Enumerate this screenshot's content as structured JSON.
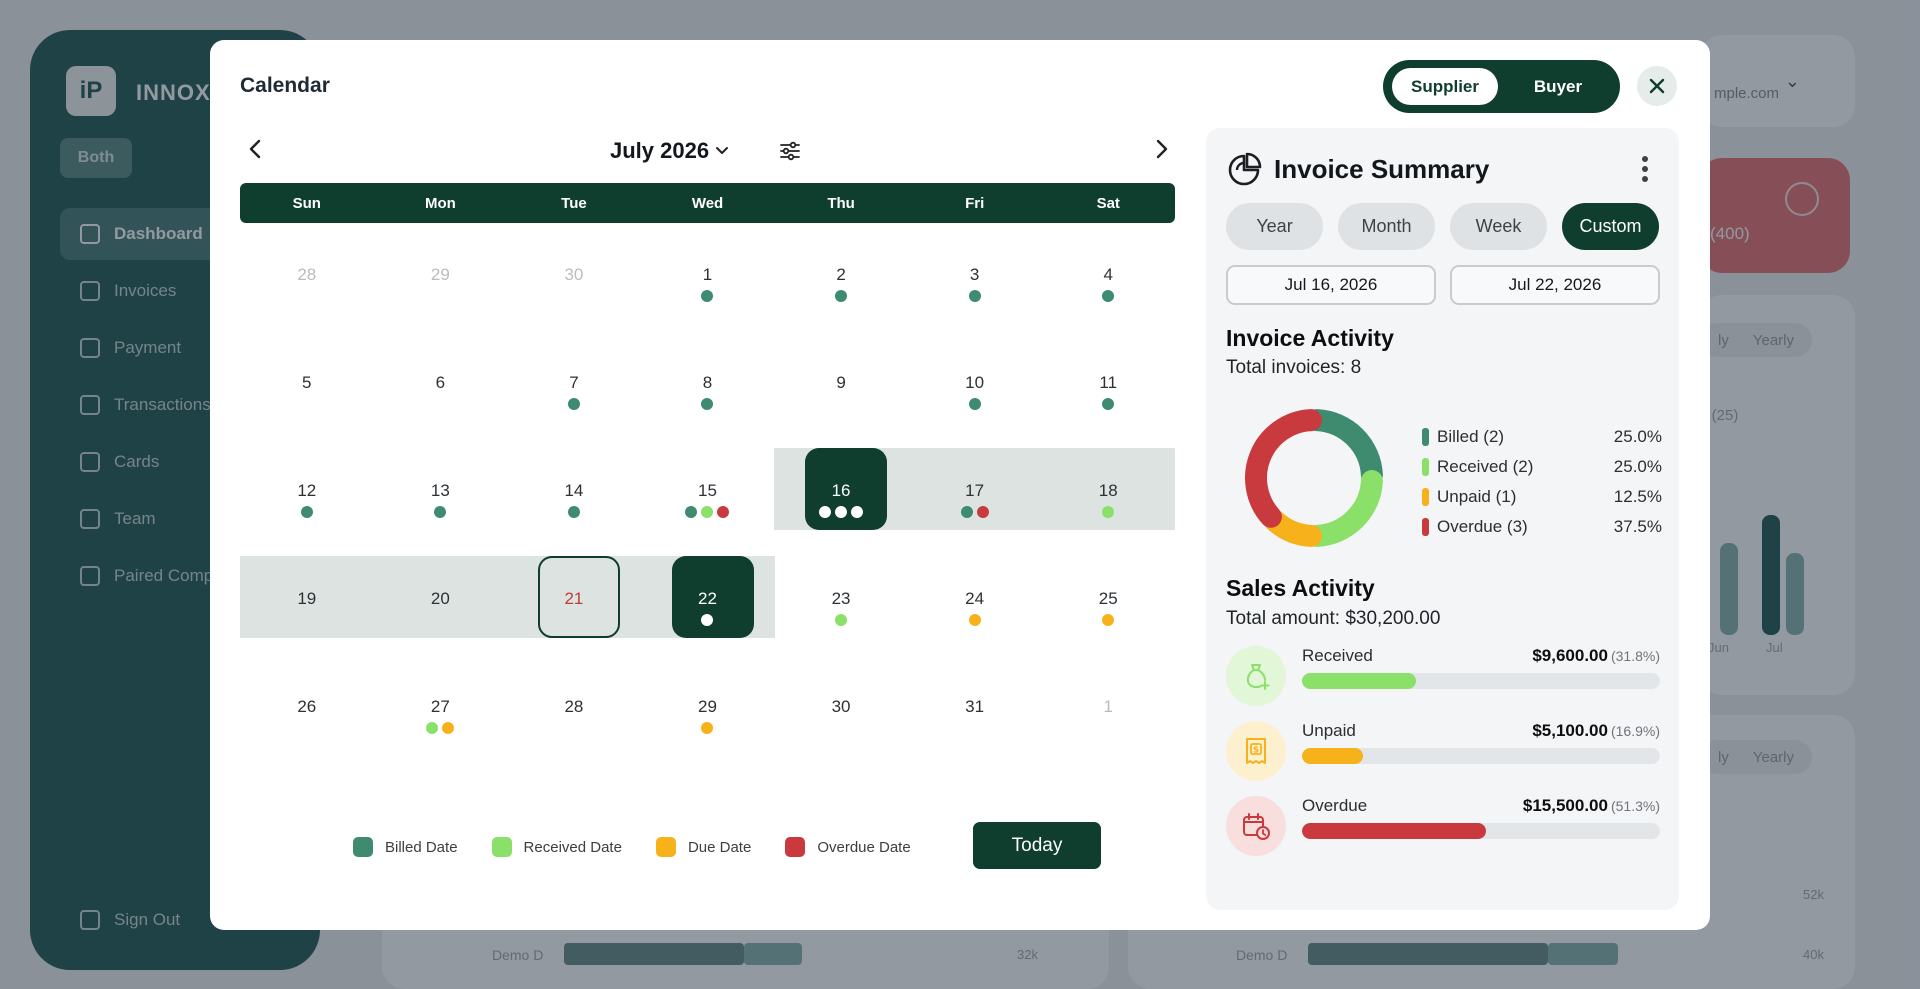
{
  "background": {
    "brand": "INNOX",
    "both_label": "Both",
    "nav": [
      "Dashboard",
      "Invoices",
      "Payment",
      "Transactions",
      "Cards",
      "Team",
      "Paired Comp"
    ],
    "sign_out": "Sign Out",
    "email_fragment": "mple.com",
    "red_card_text": "(400)",
    "pill_labels": [
      "ly",
      "Yearly"
    ],
    "bar_labels": [
      "Jun",
      "Jul"
    ],
    "series_hint": "s (25)",
    "demo_labels": [
      "Demo D",
      "Demo D"
    ],
    "values": [
      "52k",
      "32k",
      "40k"
    ]
  },
  "modal": {
    "title": "Calendar",
    "toggle": {
      "selected": "Supplier",
      "other": "Buyer"
    },
    "month_label": "July 2026",
    "weekdays": [
      "Sun",
      "Mon",
      "Tue",
      "Wed",
      "Thu",
      "Fri",
      "Sat"
    ],
    "weeks": [
      [
        {
          "day": "28",
          "muted": true,
          "dots": []
        },
        {
          "day": "29",
          "muted": true,
          "dots": []
        },
        {
          "day": "30",
          "muted": true,
          "dots": []
        },
        {
          "day": "1",
          "dots": [
            "billed"
          ]
        },
        {
          "day": "2",
          "dots": [
            "billed"
          ]
        },
        {
          "day": "3",
          "dots": [
            "billed"
          ]
        },
        {
          "day": "4",
          "dots": [
            "billed"
          ]
        }
      ],
      [
        {
          "day": "5",
          "dots": []
        },
        {
          "day": "6",
          "dots": []
        },
        {
          "day": "7",
          "dots": [
            "billed"
          ]
        },
        {
          "day": "8",
          "dots": [
            "billed"
          ]
        },
        {
          "day": "9",
          "dots": []
        },
        {
          "day": "10",
          "dots": [
            "billed"
          ]
        },
        {
          "day": "11",
          "dots": [
            "billed"
          ]
        }
      ],
      [
        {
          "day": "12",
          "dots": [
            "billed"
          ]
        },
        {
          "day": "13",
          "dots": [
            "billed"
          ]
        },
        {
          "day": "14",
          "dots": [
            "billed"
          ]
        },
        {
          "day": "15",
          "dots": [
            "billed",
            "received",
            "overdue"
          ]
        },
        {
          "day": "16",
          "selected": true,
          "dots": [
            "white",
            "white",
            "white"
          ]
        },
        {
          "day": "17",
          "dots": [
            "billed",
            "overdue"
          ]
        },
        {
          "day": "18",
          "dots": [
            "received"
          ]
        }
      ],
      [
        {
          "day": "19",
          "dots": []
        },
        {
          "day": "20",
          "dots": []
        },
        {
          "day": "21",
          "today": true,
          "dots": []
        },
        {
          "day": "22",
          "selected": true,
          "dots": [
            "white"
          ]
        },
        {
          "day": "23",
          "dots": [
            "received"
          ]
        },
        {
          "day": "24",
          "dots": [
            "due"
          ]
        },
        {
          "day": "25",
          "dots": [
            "due"
          ]
        }
      ],
      [
        {
          "day": "26",
          "dots": []
        },
        {
          "day": "27",
          "dots": [
            "received",
            "due"
          ]
        },
        {
          "day": "28",
          "dots": []
        },
        {
          "day": "29",
          "dots": [
            "due"
          ]
        },
        {
          "day": "30",
          "dots": []
        },
        {
          "day": "31",
          "dots": []
        },
        {
          "day": "1",
          "muted": true,
          "dots": []
        }
      ]
    ],
    "legend": [
      {
        "label": "Billed Date",
        "color": "#3e8b6f"
      },
      {
        "label": "Received Date",
        "color": "#8be06a"
      },
      {
        "label": "Due Date",
        "color": "#f7b21b"
      },
      {
        "label": "Overdue Date",
        "color": "#c93a3e"
      }
    ],
    "today_button": "Today"
  },
  "summary": {
    "title": "Invoice Summary",
    "periods": [
      "Year",
      "Month",
      "Week",
      "Custom"
    ],
    "active_period": "Custom",
    "start_date": "Jul 16, 2026",
    "end_date": "Jul 22, 2026",
    "invoice_activity": {
      "title": "Invoice Activity",
      "total_label": "Total invoices:",
      "total_value": "8",
      "items": [
        {
          "label": "Billed (2)",
          "pct": "25.0%",
          "fraction": 0.25,
          "color": "#3e8b6f"
        },
        {
          "label": "Received (2)",
          "pct": "25.0%",
          "fraction": 0.25,
          "color": "#8be06a"
        },
        {
          "label": "Unpaid (1)",
          "pct": "12.5%",
          "fraction": 0.125,
          "color": "#f7b21b"
        },
        {
          "label": "Overdue (3)",
          "pct": "37.5%",
          "fraction": 0.375,
          "color": "#c93a3e"
        }
      ]
    },
    "sales_activity": {
      "title": "Sales Activity",
      "total_label": "Total amount: $30,200.00",
      "items": [
        {
          "label": "Received",
          "amount": "$9,600.00",
          "pct": "(31.8%)",
          "fraction": 0.318,
          "color": "#8be06a",
          "bg": "#e2f6d8",
          "icon": "money-bag-icon"
        },
        {
          "label": "Unpaid",
          "amount": "$5,100.00",
          "pct": "(16.9%)",
          "fraction": 0.169,
          "color": "#f7b21b",
          "bg": "#fdf0cf",
          "icon": "receipt-icon"
        },
        {
          "label": "Overdue",
          "amount": "$15,500.00",
          "pct": "(51.3%)",
          "fraction": 0.513,
          "color": "#c93a3e",
          "bg": "#f9dede",
          "icon": "calendar-clock-icon"
        }
      ]
    }
  }
}
